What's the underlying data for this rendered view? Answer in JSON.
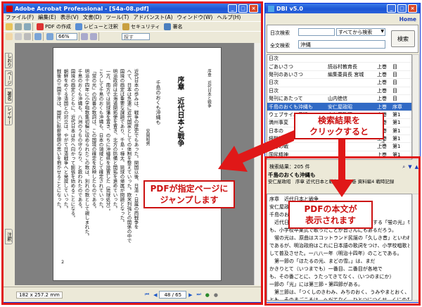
{
  "acrobat": {
    "title": "Adobe Acrobat Professional - [S4a-08.pdf]",
    "menu": [
      "ファイル(F)",
      "編集(E)",
      "表示(V)",
      "文書(D)",
      "ツール(T)",
      "アドバンスト(A)",
      "ウィンドウ(W)",
      "ヘルプ(H)"
    ],
    "toolbar1": {
      "pdf_create": "PDF の作成",
      "review": "レビューと注釈",
      "security": "セキュリティ",
      "sign": "署名"
    },
    "zoom": "66%",
    "find_placeholder": "探す",
    "side_tabs": [
      "しおり",
      "ページ",
      "署名",
      "レイヤー"
    ],
    "bottom_tab": "注釈",
    "page_size": "182 x 257.2 mm",
    "page_indicator": "48 / 65",
    "doc": {
      "header": "序章　近代日本と戦争",
      "title": "序章　近代日本と戦争",
      "subtitle": "千島のおくも沖縄も",
      "author": "安岡昭男",
      "body_cols": [
        "近代日本の歩みは、戦争の歴史でもあった。開国以後、日清・日露の両戦争を",
        "へて、日本は急速に近代国家としての体制を整えていった。欧米列強との関係の中で",
        "国境の画定は重要な課題であり、千島・樺太、琉球の帰属が問題となった。",
        "明治政府は北海道開拓使を置き、北方の防備と開拓を進めていった。",
        "一方、南方では琉球藩を置き、のちに沖縄県を設置した（琉球処分）。",
        "こうして千島のおくも沖縄も、日本の領域として確定されていった。",
        "「蛍の光」の四番の歌詞は、この国境の確定を反映したものである。",
        "明治十四年に小学唱歌集初編に収められたこの歌は、別れの歌として親しまれた。",
        "千島のおくも沖縄も、八洲のうちの守りなり、と歌われたのである。",
        "国境の画定とともに、近代日本は外へ向かって膨張を始めることになる。",
        "朝鮮をめぐる清国との対立は、やがて日清戦争へと発展していった。",
        "戦後の三国干渉は、国民に臥薪嘗胆の思いを抱かせることになった。",
        "そして日露戦争へ、近代日本は戦争の時代へと歩んでいくのである。",
        "本書は、こうした近代日本の戦争の歴史を、史料に即してたどるものである。"
      ],
      "page_no": "２"
    }
  },
  "dbi": {
    "title": "DBI v5.0",
    "home": "Home",
    "fulltext_label": "日次検索",
    "fulltext_mode": "すべてから検索",
    "fulltext_value": "",
    "title_label": "全文検索",
    "title_value": "沖縄",
    "search_btn": "検索",
    "list": [
      {
        "c1": "日次",
        "c2": "",
        "c3": "",
        "c4": ""
      },
      {
        "c1": "ごあいさつ",
        "c2": "読谷村教育長",
        "c3": "上巻",
        "c4": "目"
      },
      {
        "c1": "発刊のあいさつ",
        "c2": "編集委員長 宮城",
        "c3": "上巻",
        "c4": "目"
      },
      {
        "c1": "日次",
        "c2": "",
        "c3": "上巻",
        "c4": "目"
      },
      {
        "c1": "日次",
        "c2": "",
        "c3": "上巻",
        "c4": "目"
      },
      {
        "c1": "発刊にあたって",
        "c2": "山内徳信",
        "c3": "上巻",
        "c4": "目"
      },
      {
        "c1": "千島のおくも沖縄も",
        "c2": "安仁屋政昭",
        "c3": "上巻",
        "c4": "序章"
      },
      {
        "c1": "ウェブサイエ日戦",
        "c2": "安仁屋政昭",
        "c3": "上巻",
        "c4": "第1"
      },
      {
        "c1": "満州事変",
        "c2": "安仁屋政昭",
        "c3": "上巻",
        "c4": "第1"
      },
      {
        "c1": "日本の",
        "c2": "",
        "c3": "上巻",
        "c4": "第1"
      },
      {
        "c1": "経験時代",
        "c2": "",
        "c3": "上巻",
        "c4": "第1"
      },
      {
        "c1": "教育の戦",
        "c2": "",
        "c3": "上巻",
        "c4": "第1"
      },
      {
        "c1": "国民精神",
        "c2": "",
        "c3": "上巻",
        "c4": "第1"
      }
    ],
    "selected_index": 6,
    "result_label": "検索結果：205 件",
    "result_title": "千島のおくも沖縄も",
    "result_meta": "安仁屋政昭　序章 近代日本と戦争　第五巻 資料編4 戦時記録",
    "result_lines": [
      "序章　近代日本と戦争",
      "",
      "安仁屋政昭",
      "",
      "千島のおくも沖縄も",
      "",
      "　近代日本の国定教科書「小学唱歌集」に登場する「蛍の光」を",
      "も、小学校卒業式で歌ったことが皆さんにもあるだろう。",
      "　蛍の光は、原曲はスコットランド民謡の「久しき昔」といわれ",
      "であるが、明治政府はこれに日本語の歌詞をつけ、小学校唱歌と",
      "して普及させた。一八八一年（明治十四年）のことである。",
      "　第一節の「ほたるの光、まどの雪。」は、まだ",
      "かきりとて（いつまでも）一番目、二番目が各地で",
      "も、その番ごとに、うたってきてなく、（いつのまにか）",
      "一節の「光」には第三節・第四節がある。",
      "　第三節は、「つくしのきわみ、みちのおく、うみやまとおく、へだつ",
      "とも、そのまごころは、へだてなく、ひとつにつくせ、くにのため」で",
      "ある。",
      "　「つくし(九州)とみちのおく(みちのく=陸奥・東北地方)が、"
    ]
  },
  "callouts": {
    "click": [
      "検索結果を",
      "クリックすると"
    ],
    "jump": [
      "PDFが指定ページに",
      "ジャンプします"
    ],
    "show": [
      "PDFの本文が",
      "表示されます"
    ]
  },
  "colors": {
    "accent_red": "#cc1111",
    "xp_blue": "#1c55d4",
    "selection": "#316ac5",
    "toolbar": "#ece9d8"
  }
}
